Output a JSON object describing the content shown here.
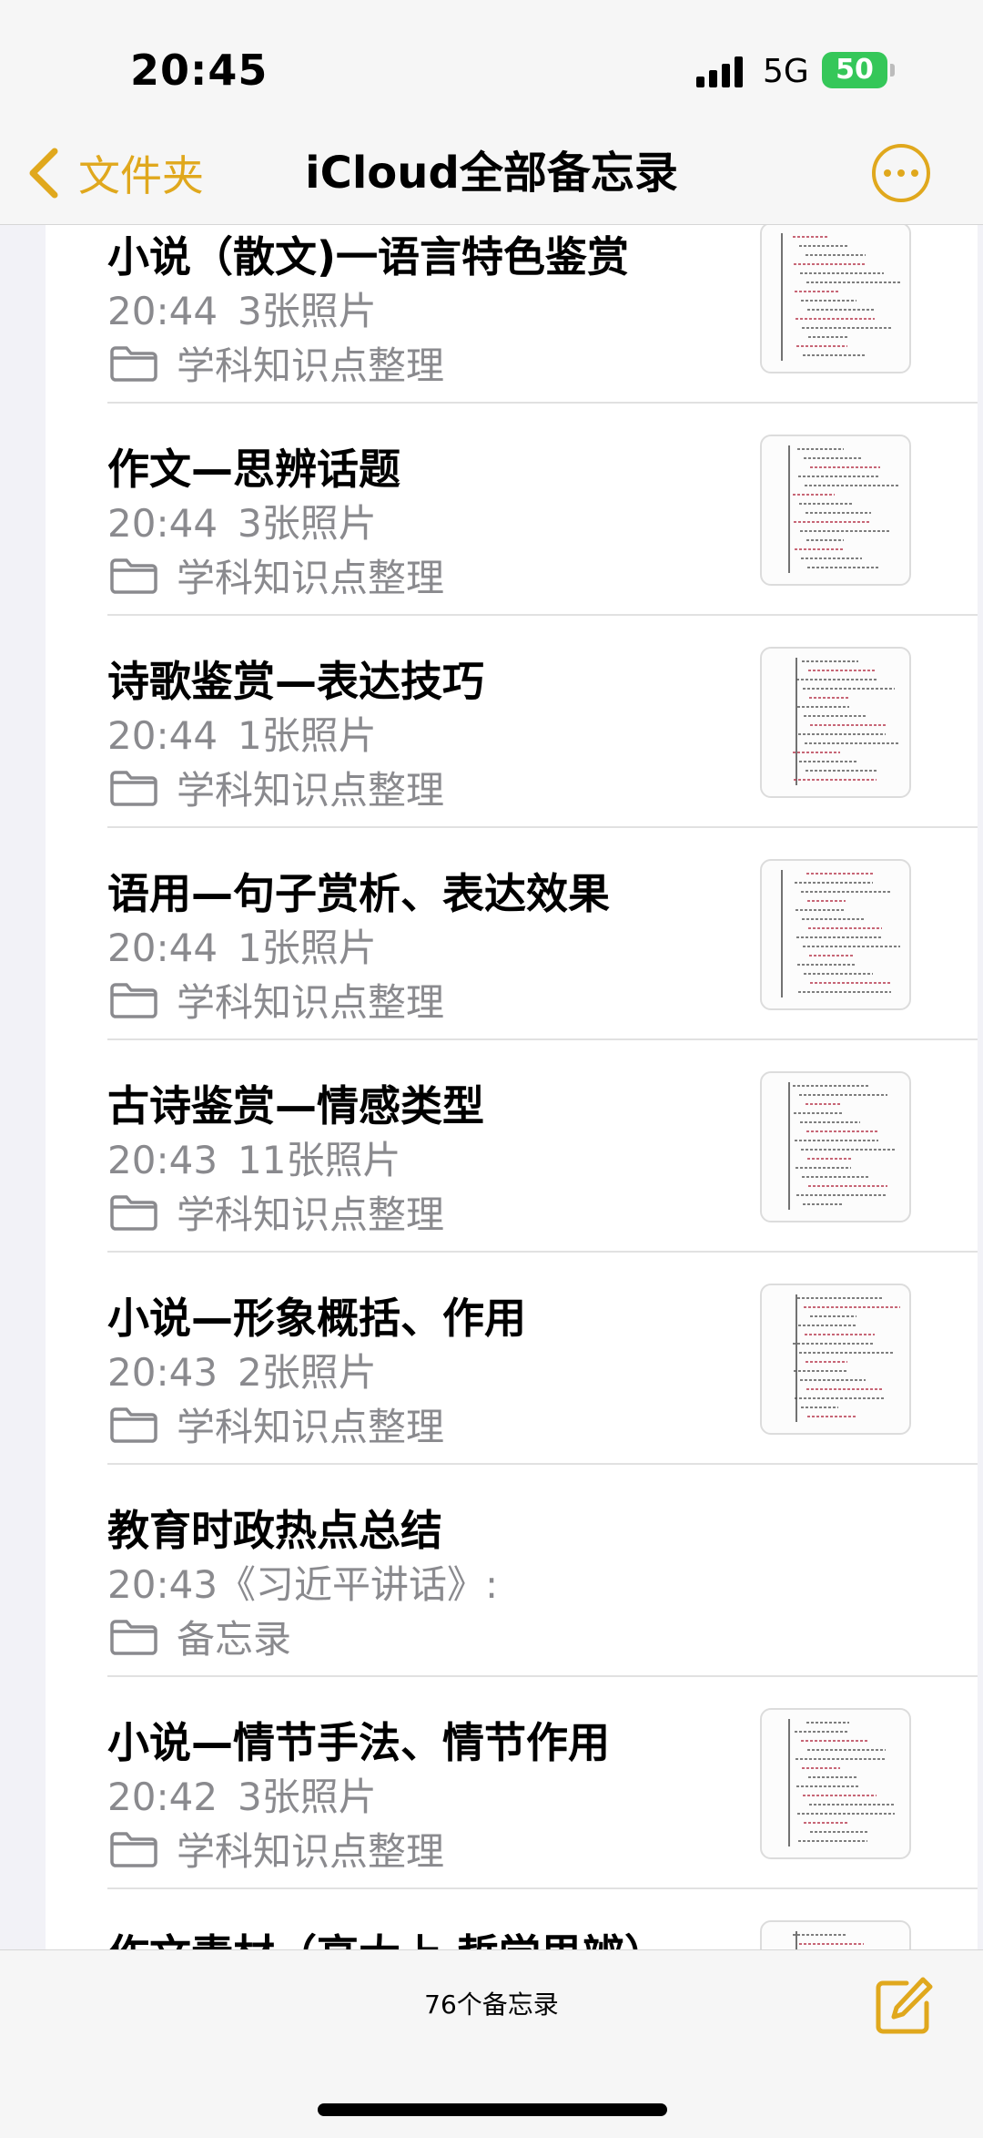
{
  "status_bar": {
    "time": "20:45",
    "network": "5G",
    "battery": "50",
    "icons": [
      "cellular-signal-icon",
      "battery-charging-icon"
    ]
  },
  "nav": {
    "back_label": "文件夹",
    "title": "iCloud全部备忘录",
    "icons": [
      "chevron-left-icon",
      "more-ellipsis-icon"
    ]
  },
  "colors": {
    "accent": "#e0a81d",
    "secondary_text": "#8a8a8e",
    "battery_green": "#35c759"
  },
  "notes": [
    {
      "title": "小说（散文)一语言特色鉴赏",
      "time": "20:44",
      "preview": "3张照片",
      "folder": "学科知识点整理",
      "has_thumbnail": true
    },
    {
      "title": "作文—思辨话题",
      "time": "20:44",
      "preview": "3张照片",
      "folder": "学科知识点整理",
      "has_thumbnail": true
    },
    {
      "title": "诗歌鉴赏—表达技巧",
      "time": "20:44",
      "preview": "1张照片",
      "folder": "学科知识点整理",
      "has_thumbnail": true
    },
    {
      "title": "语用—句子赏析、表达效果",
      "time": "20:44",
      "preview": "1张照片",
      "folder": "学科知识点整理",
      "has_thumbnail": true
    },
    {
      "title": "古诗鉴赏—情感类型",
      "time": "20:43",
      "preview": "11张照片",
      "folder": "学科知识点整理",
      "has_thumbnail": true
    },
    {
      "title": "小说—形象概括、作用",
      "time": "20:43",
      "preview": "2张照片",
      "folder": "学科知识点整理",
      "has_thumbnail": true
    },
    {
      "title": "教育时政热点总结",
      "time": "20:43",
      "preview": "《习近平讲话》:",
      "folder": "备忘录",
      "has_thumbnail": false
    },
    {
      "title": "小说—情节手法、情节作用",
      "time": "20:42",
      "preview": "3张照片",
      "folder": "学科知识点整理",
      "has_thumbnail": true
    },
    {
      "title": "作文素材（高大上 哲学思辨）",
      "time": "",
      "preview": "",
      "folder": "",
      "has_thumbnail": true
    }
  ],
  "toolbar": {
    "count_label": "76个备忘录",
    "icons": [
      "compose-icon"
    ]
  }
}
